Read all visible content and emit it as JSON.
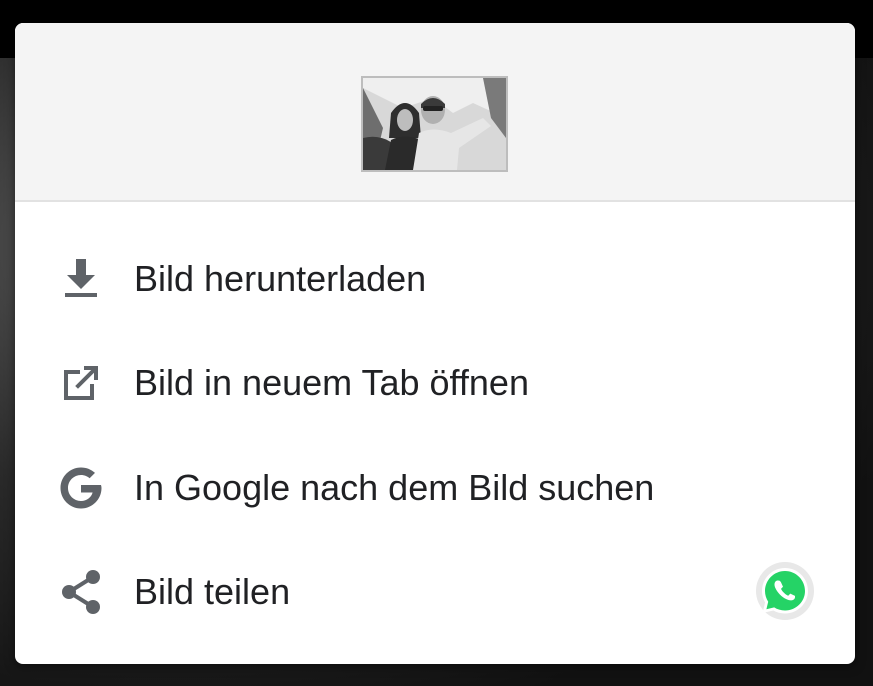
{
  "dialog": {
    "image_alt": "Selfie of two people",
    "items": [
      {
        "label": "Bild herunterladen",
        "icon": "download-icon"
      },
      {
        "label": "Bild in neuem Tab öffnen",
        "icon": "open-in-new-icon"
      },
      {
        "label": "In Google nach dem Bild suchen",
        "icon": "google-g-icon"
      },
      {
        "label": "Bild teilen",
        "icon": "share-icon"
      }
    ],
    "quick_share_app": "whatsapp-icon"
  },
  "colors": {
    "text": "#202124",
    "icon": "#5f6368",
    "header_bg": "#f4f4f4",
    "whatsapp_green": "#25d366"
  }
}
